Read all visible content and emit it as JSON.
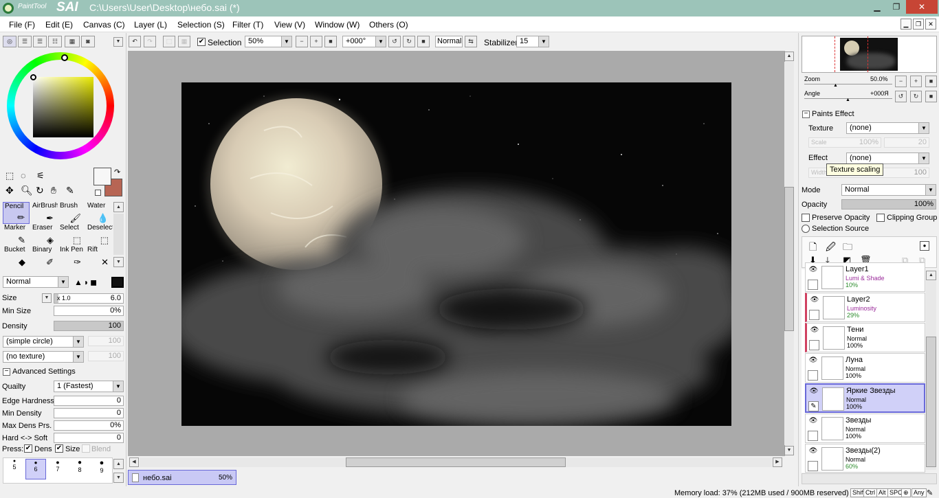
{
  "window": {
    "title": "C:\\Users\\User\\Desktop\\небо.sai (*)",
    "logo_small": "PaintTool",
    "logo_big": "SAI",
    "min": "▁",
    "max": "❐",
    "close": "✕"
  },
  "menu": [
    "File (F)",
    "Edit (E)",
    "Canvas (C)",
    "Layer (L)",
    "Selection (S)",
    "Filter (T)",
    "View (V)",
    "Window (W)",
    "Others (O)"
  ],
  "toolbar": {
    "selection_label": "Selection",
    "zoom": "50%",
    "angle": "+000°",
    "blend": "Normal",
    "stabilizer_label": "Stabilizer",
    "stabilizer": "15"
  },
  "tools": {
    "grid": [
      {
        "name": "Pencil",
        "icon": "✏"
      },
      {
        "name": "AirBrush",
        "icon": "✒"
      },
      {
        "name": "Brush",
        "icon": "🖌"
      },
      {
        "name": "Water",
        "icon": "💧"
      },
      {
        "name": "Marker",
        "icon": "✎"
      },
      {
        "name": "Eraser",
        "icon": "◈"
      },
      {
        "name": "Select",
        "icon": "⬚"
      },
      {
        "name": "Deselect",
        "icon": "⬚"
      },
      {
        "name": "Bucket",
        "icon": "◆"
      },
      {
        "name": "Binary",
        "icon": "✐"
      },
      {
        "name": "Ink Pen",
        "icon": "✑"
      },
      {
        "name": "Rift",
        "icon": "✕"
      }
    ],
    "blend_mode": "Normal",
    "size_label": "Size",
    "size_mult": "x 1.0",
    "size": "6.0",
    "min_size_label": "Min Size",
    "min_size": "0%",
    "density_label": "Density",
    "density": "100",
    "shape": "(simple circle)",
    "shape_val": "100",
    "texture": "(no texture)",
    "texture_val": "100",
    "advanced": "Advanced Settings",
    "quality_label": "Quailty",
    "quality": "1 (Fastest)",
    "edge_label": "Edge Hardness",
    "edge": "0",
    "mindens_label": "Min Density",
    "mindens": "0",
    "maxdens_label": "Max Dens Prs.",
    "maxdens": "0%",
    "hardsoft_label": "Hard <-> Soft",
    "hardsoft": "0",
    "press_label": "Press:",
    "press_dens": "Dens",
    "press_size": "Size",
    "press_blend": "Blend",
    "brush_sizes": [
      "5",
      "6",
      "7",
      "8",
      "9"
    ]
  },
  "canvas": {
    "tab_name": "небо.sai",
    "tab_zoom": "50%"
  },
  "navigator": {
    "zoom_label": "Zoom",
    "zoom": "50.0%",
    "angle_label": "Angle",
    "angle": "+000Я"
  },
  "paints_effect": {
    "header": "Paints Effect",
    "texture_label": "Texture",
    "texture": "(none)",
    "scale_label": "Scale",
    "scale": "100%",
    "scale2": "20",
    "effect_label": "Effect",
    "effect": "(none)",
    "width_label": "Width",
    "width_val": "100",
    "tooltip": "Texture scaling"
  },
  "layer_props": {
    "mode_label": "Mode",
    "mode": "Normal",
    "opacity_label": "Opacity",
    "opacity": "100%",
    "preserve": "Preserve Opacity",
    "clipping": "Clipping Group",
    "selsource": "Selection Source"
  },
  "layers": [
    {
      "name": "Layer1",
      "mode": "Lumi & Shade",
      "opacity": "10%",
      "mode_color": "#9a2a9a",
      "op_color": "#2a8a2a"
    },
    {
      "name": "Layer2",
      "mode": "Luminosity",
      "opacity": "29%",
      "mode_color": "#9a2a9a",
      "op_color": "#2a8a2a"
    },
    {
      "name": "Тени",
      "mode": "Normal",
      "opacity": "100%",
      "mode_color": "#000000",
      "op_color": "#000000"
    },
    {
      "name": "Луна",
      "mode": "Normal",
      "opacity": "100%",
      "mode_color": "#000000",
      "op_color": "#000000"
    },
    {
      "name": "Яркие Звезды",
      "mode": "Normal",
      "opacity": "100%",
      "mode_color": "#000000",
      "op_color": "#000000"
    },
    {
      "name": "Звезды",
      "mode": "Normal",
      "opacity": "100%",
      "mode_color": "#000000",
      "op_color": "#000000"
    },
    {
      "name": "Звезды(2)",
      "mode": "Normal",
      "opacity": "60%",
      "mode_color": "#000000",
      "op_color": "#2a8a2a"
    }
  ],
  "status": {
    "memory": "Memory load: 37% (212MB used / 900MB reserved)",
    "keys": [
      "Shift",
      "Ctrl",
      "Alt",
      "SPC",
      "⊕",
      "Any"
    ]
  },
  "colors": {
    "title_bg": "#9cc4b9",
    "accent": "#6868d8",
    "fg_color": "#f7f7f7",
    "bg_color": "#b76554"
  }
}
